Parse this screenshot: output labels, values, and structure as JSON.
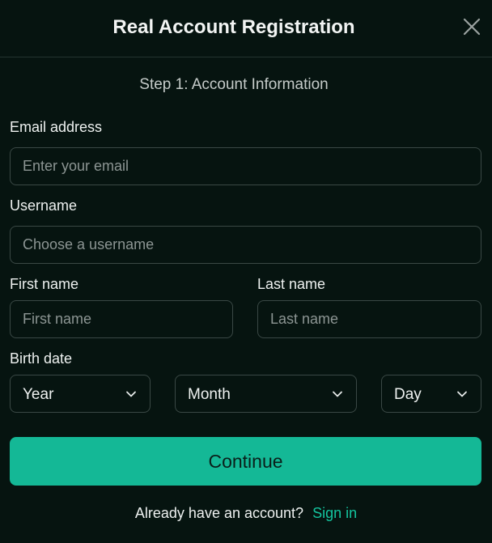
{
  "dialog": {
    "title": "Real Account Registration",
    "step": "Step 1: Account Information"
  },
  "form": {
    "email": {
      "label": "Email address",
      "placeholder": "Enter your email",
      "value": ""
    },
    "username": {
      "label": "Username",
      "placeholder": "Choose a username",
      "value": ""
    },
    "first_name": {
      "label": "First name",
      "placeholder": "First name",
      "value": ""
    },
    "last_name": {
      "label": "Last name",
      "placeholder": "Last name",
      "value": ""
    },
    "birth_date": {
      "label": "Birth date",
      "year": "Year",
      "month": "Month",
      "day": "Day"
    },
    "continue_label": "Continue"
  },
  "footer": {
    "prompt": "Already have an account?",
    "signin_label": "Sign in"
  },
  "icons": {
    "close": "close-icon",
    "chevron": "chevron-down-icon"
  },
  "colors": {
    "background": "#061410",
    "accent": "#14b896",
    "link": "#14c59f",
    "border": "#3a4845"
  }
}
